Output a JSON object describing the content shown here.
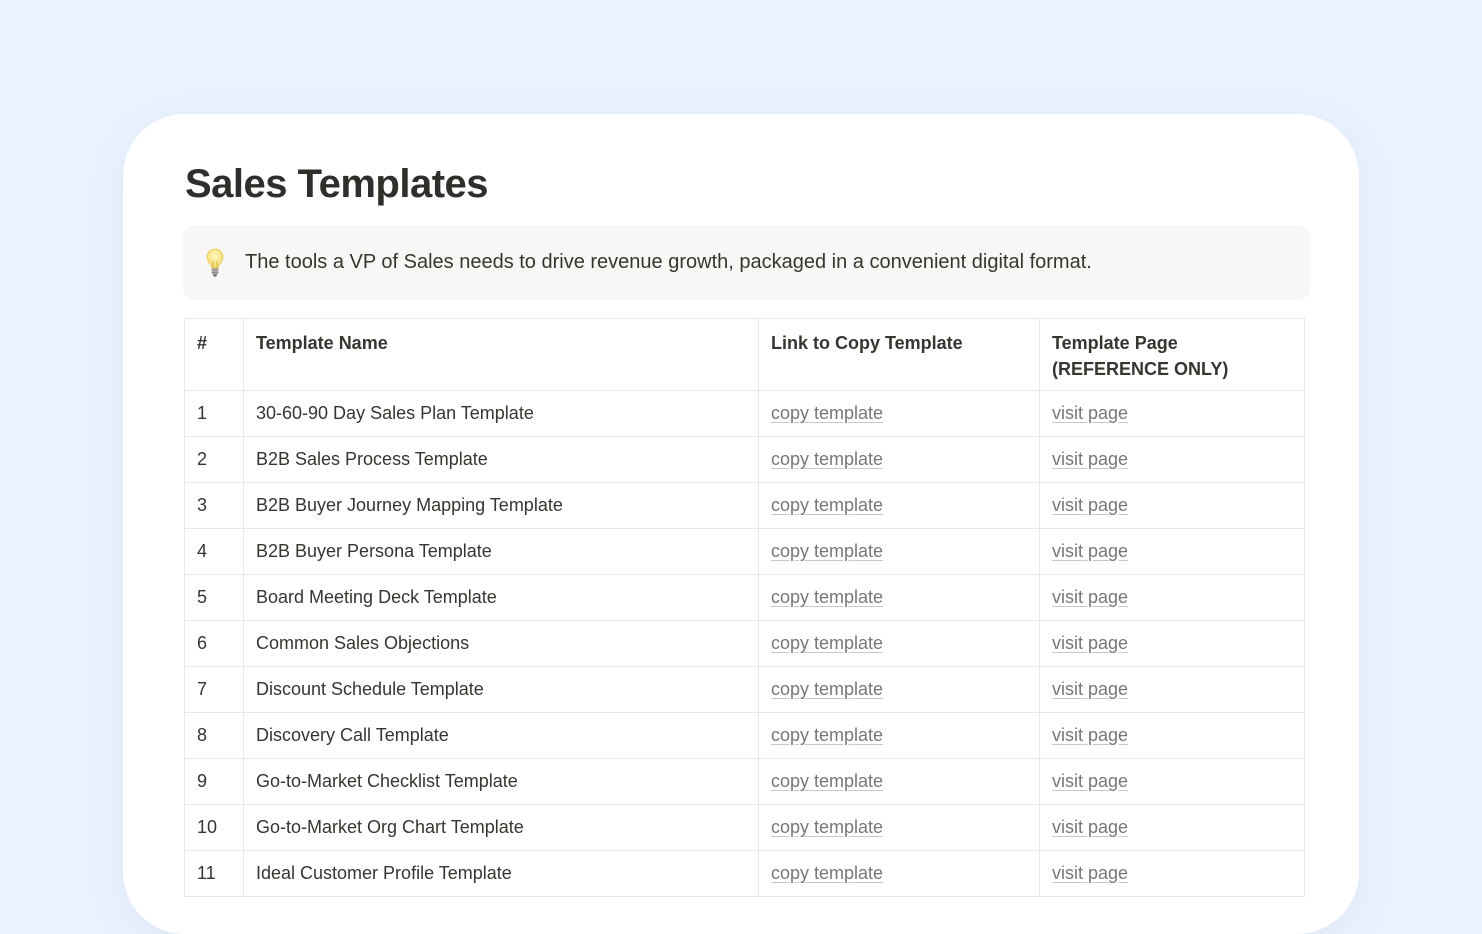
{
  "page": {
    "title": "Sales Templates",
    "callout": {
      "icon": "lightbulb-icon",
      "text": "The tools a VP of Sales needs to drive revenue growth, packaged in a convenient digital format."
    }
  },
  "table": {
    "headers": {
      "num": "#",
      "name": "Template Name",
      "copy": "Link to Copy Template",
      "page_line1": "Template Page",
      "page_line2": "(REFERENCE ONLY)"
    },
    "rows": [
      {
        "num": "1",
        "name": "30-60-90 Day Sales Plan Template",
        "copy": "copy template",
        "visit": "visit page"
      },
      {
        "num": "2",
        "name": "B2B Sales Process Template",
        "copy": "copy template",
        "visit": "visit page"
      },
      {
        "num": "3",
        "name": "B2B Buyer Journey Mapping Template",
        "copy": "copy template",
        "visit": "visit page"
      },
      {
        "num": "4",
        "name": "B2B Buyer Persona Template",
        "copy": "copy template",
        "visit": "visit page"
      },
      {
        "num": "5",
        "name": "Board Meeting Deck Template",
        "copy": "copy template",
        "visit": "visit page"
      },
      {
        "num": "6",
        "name": "Common Sales Objections",
        "copy": "copy template",
        "visit": "visit page"
      },
      {
        "num": "7",
        "name": "Discount Schedule Template",
        "copy": "copy template",
        "visit": "visit page"
      },
      {
        "num": "8",
        "name": "Discovery Call Template",
        "copy": "copy template",
        "visit": "visit page"
      },
      {
        "num": "9",
        "name": "Go-to-Market Checklist Template",
        "copy": "copy template",
        "visit": "visit page"
      },
      {
        "num": "10",
        "name": "Go-to-Market Org Chart Template",
        "copy": "copy template",
        "visit": "visit page"
      },
      {
        "num": "11",
        "name": "Ideal Customer Profile Template",
        "copy": "copy template",
        "visit": "visit page"
      }
    ]
  },
  "colors": {
    "background": "#eaf2fe",
    "card": "#ffffff",
    "callout": "#f8f7f5",
    "text": "#37352f",
    "link": "#787774",
    "border": "#e9e9e7"
  }
}
